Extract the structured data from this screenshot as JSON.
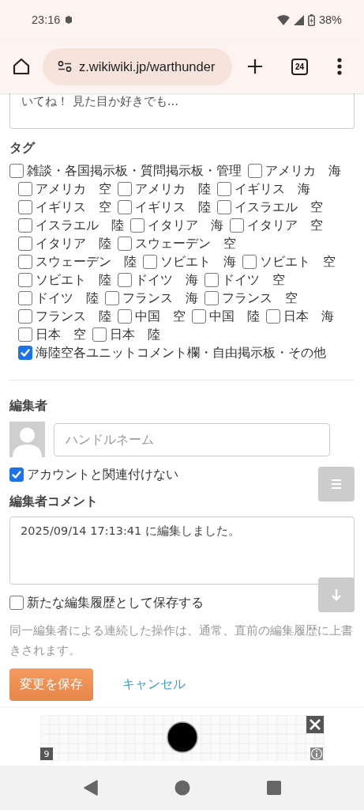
{
  "status_bar": {
    "time": "23:16",
    "battery": "38%"
  },
  "browser": {
    "url": "z.wikiwiki.jp/warthunder",
    "tab_count": "24"
  },
  "comment_preview": {
    "value": "いてね！ 見た目か好きでも..."
  },
  "tags": {
    "heading": "タグ",
    "items": [
      {
        "label": "雑談・各国掲示板・質問掲示板・管理",
        "checked": false
      },
      {
        "label": "アメリカ　海",
        "checked": false
      },
      {
        "label": "アメリカ　空",
        "checked": false
      },
      {
        "label": "アメリカ　陸",
        "checked": false
      },
      {
        "label": "イギリス　海",
        "checked": false
      },
      {
        "label": "イギリス　空",
        "checked": false
      },
      {
        "label": "イギリス　陸",
        "checked": false
      },
      {
        "label": "イスラエル　空",
        "checked": false
      },
      {
        "label": "イスラエル　陸",
        "checked": false
      },
      {
        "label": "イタリア　海",
        "checked": false
      },
      {
        "label": "イタリア　空",
        "checked": false
      },
      {
        "label": "イタリア　陸",
        "checked": false
      },
      {
        "label": "スウェーデン　空",
        "checked": false
      },
      {
        "label": "スウェーデン　陸",
        "checked": false
      },
      {
        "label": "ソビエト　海",
        "checked": false
      },
      {
        "label": "ソビエト　空",
        "checked": false
      },
      {
        "label": "ソビエト　陸",
        "checked": false
      },
      {
        "label": "ドイツ　海",
        "checked": false
      },
      {
        "label": "ドイツ　空",
        "checked": false
      },
      {
        "label": "ドイツ　陸",
        "checked": false
      },
      {
        "label": "フランス　海",
        "checked": false
      },
      {
        "label": "フランス　空",
        "checked": false
      },
      {
        "label": "フランス　陸",
        "checked": false
      },
      {
        "label": "中国　空",
        "checked": false
      },
      {
        "label": "中国　陸",
        "checked": false
      },
      {
        "label": "日本　海",
        "checked": false
      },
      {
        "label": "日本　空",
        "checked": false
      },
      {
        "label": "日本　陸",
        "checked": false
      },
      {
        "label": "海陸空各ユニットコメント欄・自由掲示板・その他",
        "checked": true
      }
    ]
  },
  "editor": {
    "heading": "編集者",
    "name_field": {
      "placeholder": "ハンドルネーム"
    },
    "unlink_account": {
      "label": "アカウントと関連付けない",
      "checked": true
    }
  },
  "editor_comment": {
    "heading": "編集者コメント",
    "value": "2025/09/14 17:13:41 に編集しました。"
  },
  "new_revision": {
    "label": "新たな編集履歴として保存する",
    "checked": false
  },
  "note": "同一編集者による連続した操作は、通常、直前の編集履歴に上書きされます。",
  "actions": [
    {
      "kind": "primary",
      "label": "変更を保存"
    },
    {
      "kind": "link",
      "label": "キャンセル"
    }
  ],
  "ad": {
    "counter": "9"
  }
}
